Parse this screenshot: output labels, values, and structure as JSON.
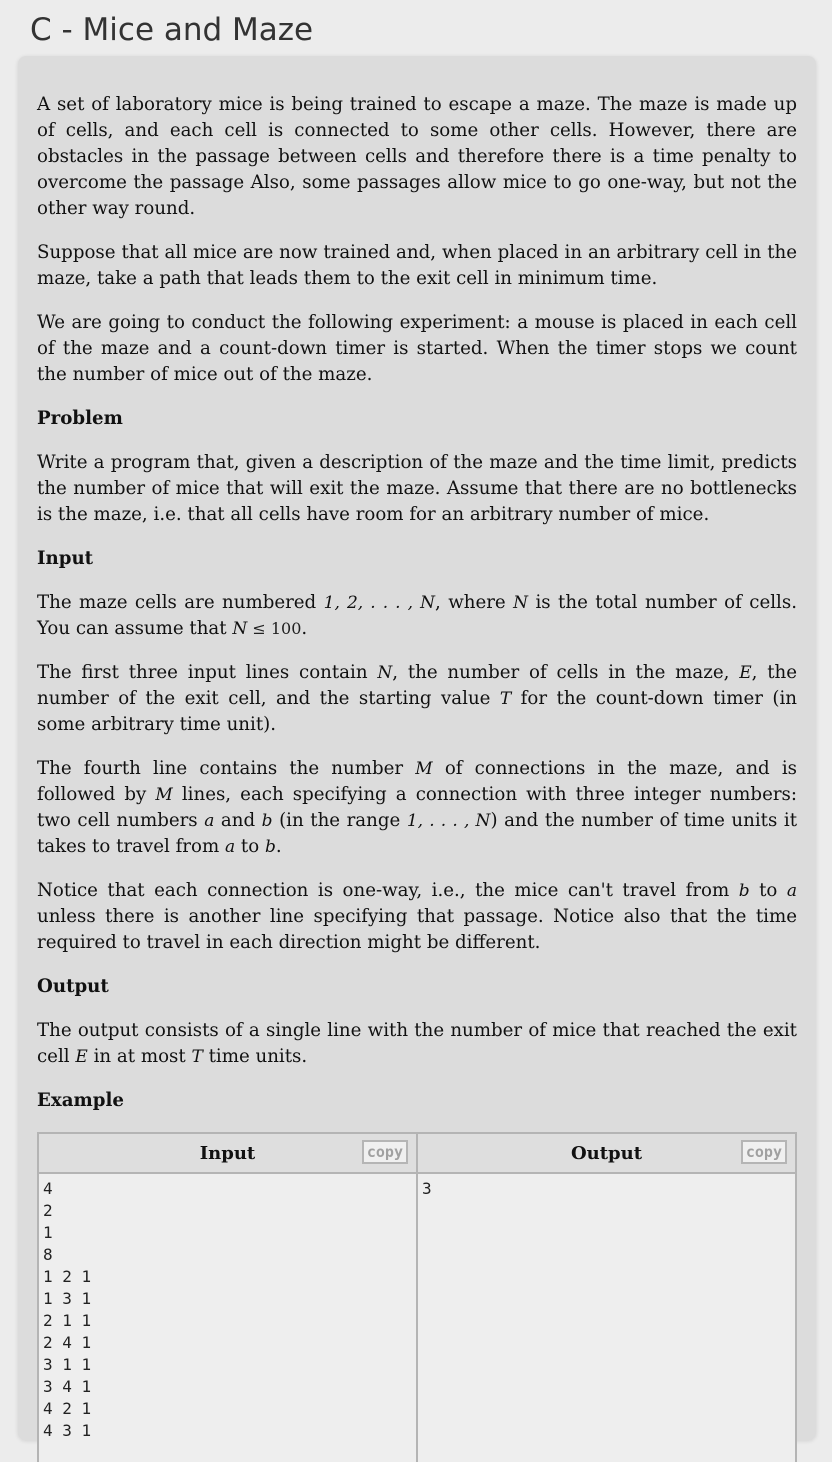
{
  "title": "C - Mice and Maze",
  "paragraphs": {
    "p1": "A set of laboratory mice is being trained to escape a maze. The maze is made up of cells, and each cell is connected to some other cells. However, there are obstacles in the passage between cells and therefore there is a time penalty to overcome the passage Also, some passages allow mice to go one-way, but not the other way round.",
    "p2": "Suppose that all mice are now trained and, when placed in an arbitrary cell in the maze, take a path that leads them to the exit cell in minimum time.",
    "p3": "We are going to conduct the following experiment: a mouse is placed in each cell of the maze and a count-down timer is started. When the timer stops we count the number of mice out of the maze.",
    "p4": "Write a program that, given a description of the maze and the time limit, predicts the number of mice that will exit the maze. Assume that there are no bottlenecks is the maze, i.e. that all cells have room for an arbitrary number of mice.",
    "p5a": "The maze cells are numbered ",
    "p5b": ", where ",
    "p5c": " is the total number of cells. You can assume that ",
    "p5d": ".",
    "p6a": "The first three input lines contain ",
    "p6b": ", the number of cells in the maze, ",
    "p6c": ", the number of the exit cell, and the starting value ",
    "p6d": " for the count-down timer (in some arbitrary time unit).",
    "p7a": "The fourth line contains the number ",
    "p7b": " of connections in the maze, and is followed by ",
    "p7c": " lines, each specifying a connection with three integer numbers: two cell numbers ",
    "p7d": " and ",
    "p7e": " (in the range ",
    "p7f": ") and the number of time units it takes to travel from ",
    "p7g": " to ",
    "p7h": ".",
    "p8a": "Notice that each connection is one-way, i.e., the mice can't travel from ",
    "p8b": " to ",
    "p8c": " unless there is another line specifying that passage. Notice also that the time required to travel in each direction might be different.",
    "p9a": "The output consists of a single line with the number of mice that reached the exit cell ",
    "p9b": " in at most ",
    "p9c": " time units."
  },
  "math": {
    "cells_range": "1, 2, . . . , N",
    "N": "N",
    "bound_var": "N",
    "bound_op": " ≤ ",
    "bound_val": "100",
    "E": "E",
    "T": "T",
    "M": "M",
    "a": "a",
    "b": "b",
    "range_1_N": "1, . . . , N"
  },
  "headings": {
    "problem": "Problem",
    "input": "Input",
    "output": "Output",
    "example": "Example"
  },
  "example": {
    "input_header": "Input",
    "output_header": "Output",
    "copy_label": "copy",
    "input_text": "4\n2\n1\n8\n1 2 1\n1 3 1\n2 1 1\n2 4 1\n3 1 1\n3 4 1\n4 2 1\n4 3 1",
    "output_text": "3"
  }
}
